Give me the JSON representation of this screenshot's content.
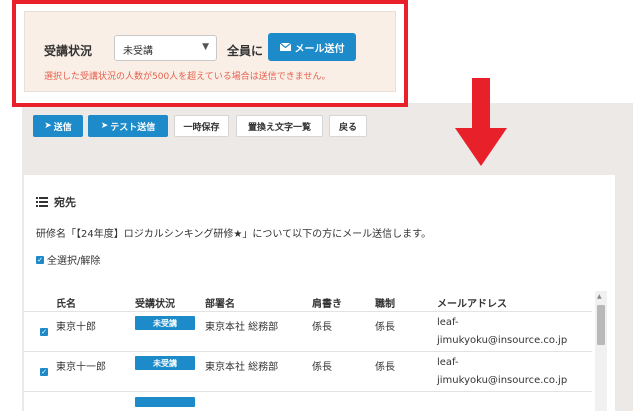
{
  "filter": {
    "label": "受講状況",
    "select_value": "未受講",
    "all_label": "全員に",
    "mail_button": "メール送付",
    "warning": "選択した受講状況の人数が500人を超えている場合は送信できません。"
  },
  "toolbar": {
    "send": "送信",
    "test_send": "テスト送信",
    "temp_save": "一時保存",
    "replace_list": "置換え文字一覧",
    "back": "戻る"
  },
  "recipients": {
    "title": "宛先",
    "description": "研修名「【24年度】ロジカルシンキング研修★」について以下の方にメール送信します。",
    "select_all": "全選択/解除",
    "headers": {
      "name": "氏名",
      "status": "受講状況",
      "dept": "部署名",
      "title": "肩書き",
      "position": "職制",
      "email": "メールアドレス"
    },
    "rows": [
      {
        "name": "東京十郎",
        "status": "未受講",
        "dept": "東京本社 総務部",
        "title": "係長",
        "position": "係長",
        "email_1": "leaf-",
        "email_2": "jimukyoku@insource.co.jp"
      },
      {
        "name": "東京十一郎",
        "status": "未受講",
        "dept": "東京本社 総務部",
        "title": "係長",
        "position": "係長",
        "email_1": "leaf-",
        "email_2": "jimukyoku@insource.co.jp"
      }
    ]
  },
  "colors": {
    "accent": "#1d8ac9",
    "highlight": "#e8202a",
    "warning": "#e8614f"
  }
}
